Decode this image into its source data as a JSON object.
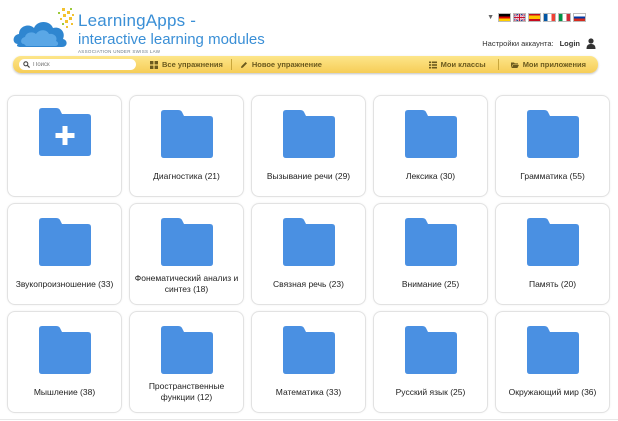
{
  "brand": {
    "title": "LearningApps -",
    "subtitle": "interactive learning modules",
    "tagline": "ASSOCIATION UNDER SWISS LAW"
  },
  "flags": [
    "de",
    "gb",
    "es",
    "fr",
    "it",
    "ru"
  ],
  "account": {
    "settings_label": "Настройки аккаунта:",
    "login_label": "Login"
  },
  "nav": {
    "search_placeholder": "Поиск",
    "all_exercises": "Все упражнения",
    "new_exercise": "Новое упражнение",
    "my_classes": "Мои классы",
    "my_apps": "Мои приложения"
  },
  "folders": [
    {
      "label": ""
    },
    {
      "label": "Диагностика (21)"
    },
    {
      "label": "Вызывание речи (29)"
    },
    {
      "label": "Лексика (30)"
    },
    {
      "label": "Грамматика (55)"
    },
    {
      "label": "Звукопроизношение (33)"
    },
    {
      "label": "Фонематический анализ и синтез (18)"
    },
    {
      "label": "Связная речь (23)"
    },
    {
      "label": "Внимание (25)"
    },
    {
      "label": "Память (20)"
    },
    {
      "label": "Мышление (38)"
    },
    {
      "label": "Пространственные функции (12)"
    },
    {
      "label": "Математика (33)"
    },
    {
      "label": "Русский язык (25)"
    },
    {
      "label": "Окружающий мир (36)"
    }
  ],
  "colors": {
    "folder": "#4a90e2",
    "navbar": "#f6cd57",
    "brand": "#3a8fd6"
  }
}
